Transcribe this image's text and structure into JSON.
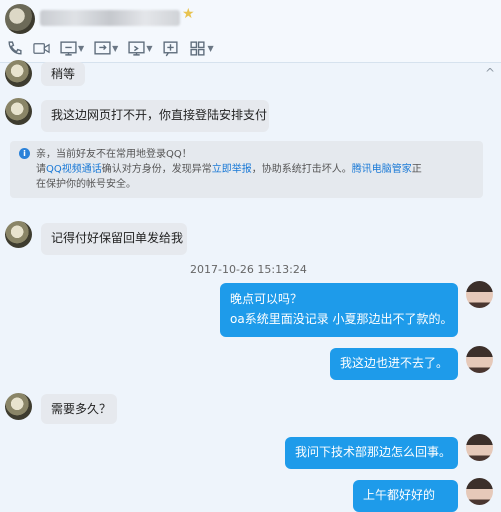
{
  "header": {
    "star_icon": "star-icon"
  },
  "toolbar": {
    "icons": [
      "phone-icon",
      "video-icon",
      "screen-share-icon",
      "remote-assist-icon",
      "desktop-icon",
      "add-icon",
      "apps-icon"
    ]
  },
  "messages": {
    "m1": "稍等",
    "m2": "我这边网页打不开，你直接登陆安排支付",
    "m3": "记得付好保留回单发给我",
    "timestamp": "2017-10-26 15:13:24",
    "m4_line1": "晚点可以吗？",
    "m4_line2": "oa系统里面没记录 小夏那边出不了款的。",
    "m5": "我这边也进不去了。",
    "m6": "需要多久？",
    "m7": "我问下技术部那边怎么回事。",
    "m8": "上午都好好的"
  },
  "tip": {
    "l1": "亲，当前好友不在常用地登录QQ！",
    "l2_a": "请",
    "l2_link1": "QQ视频通话",
    "l2_b": "确认对方身份，发现异常",
    "l2_link2": "立即举报",
    "l2_c": "，协助系统打击坏人。",
    "l2_link3": "腾讯电脑管家",
    "l2_d": "正",
    "l3": "在保护你的帐号安全。"
  }
}
